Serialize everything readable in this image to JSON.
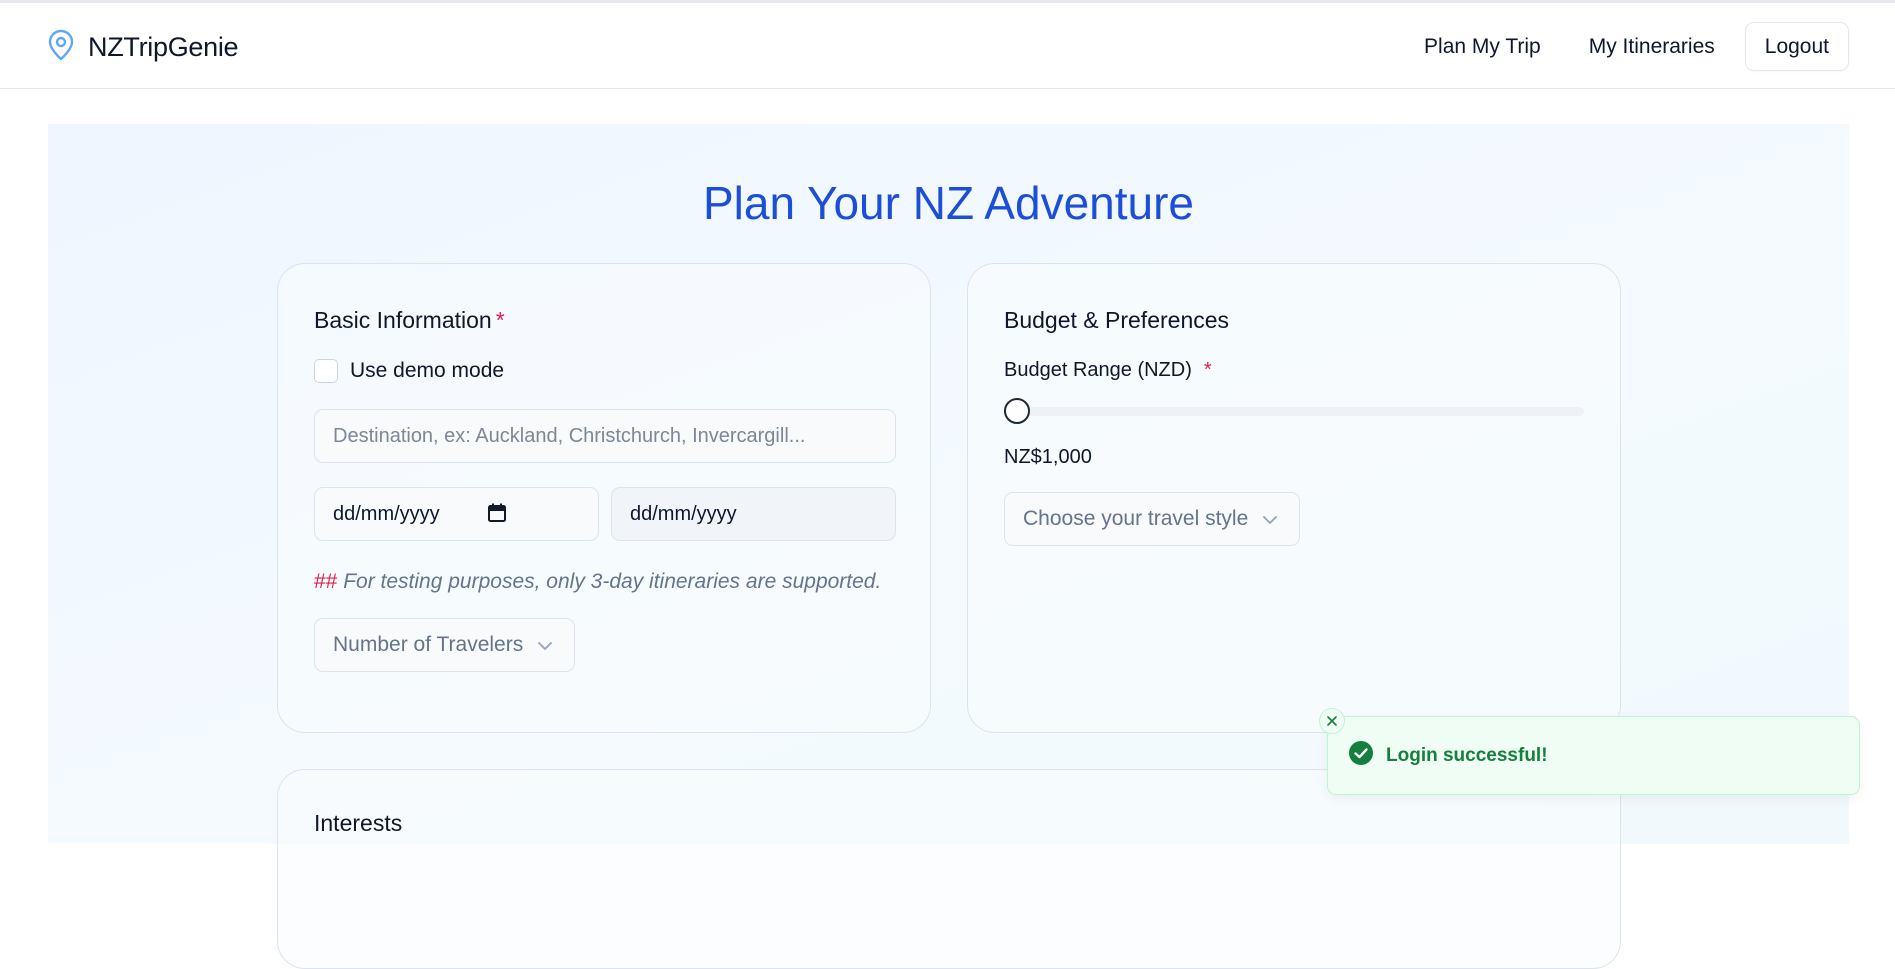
{
  "app": {
    "name": "NZTripGenie",
    "brand_icon": "map-pin-icon",
    "accent": "#1d4ed8"
  },
  "nav": {
    "plan_my_trip": "Plan My Trip",
    "my_itineraries": "My Itineraries",
    "logout": "Logout"
  },
  "page": {
    "title": "Plan Your NZ Adventure"
  },
  "basic": {
    "title": "Basic Information",
    "required_mark": "*",
    "demo_mode_label": "Use demo mode",
    "demo_mode_checked": false,
    "destination_placeholder": "Destination, ex: Auckland, Christchurch, Invercargill...",
    "start_date": "dd/mm/yyyy",
    "end_date": "dd/mm/yyyy",
    "note_hash": "##",
    "note_text": "For testing purposes, only 3-day itineraries are supported.",
    "travelers_placeholder": "Number of Travelers"
  },
  "budget": {
    "title": "Budget & Preferences",
    "range_label": "Budget Range (NZD)",
    "required_mark": "*",
    "value_text": "NZ$1,000",
    "slider_fraction": 0,
    "style_placeholder": "Choose your travel style"
  },
  "interests": {
    "title": "Interests"
  },
  "toast": {
    "message": "Login successful!",
    "icon": "check-circle-icon",
    "color": "#15803d"
  }
}
